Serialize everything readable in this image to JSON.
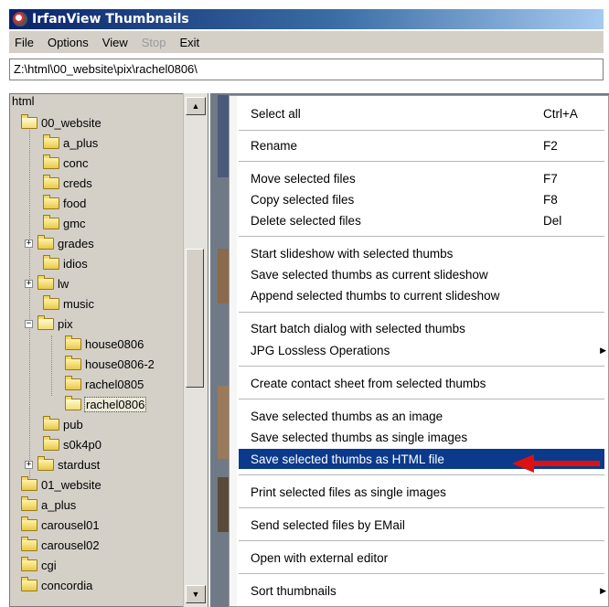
{
  "window": {
    "title": "IrfanView Thumbnails"
  },
  "menubar": {
    "items": [
      {
        "label": "File",
        "enabled": true
      },
      {
        "label": "Options",
        "enabled": true
      },
      {
        "label": "View",
        "enabled": true
      },
      {
        "label": "Stop",
        "enabled": false
      },
      {
        "label": "Exit",
        "enabled": true
      }
    ]
  },
  "address": {
    "path": "Z:\\html\\00_website\\pix\\rachel0806\\"
  },
  "tree": {
    "root_label": "html",
    "items": [
      {
        "label": "00_website",
        "expander": ""
      },
      {
        "label": "a_plus",
        "expander": ""
      },
      {
        "label": "conc",
        "expander": ""
      },
      {
        "label": "creds",
        "expander": ""
      },
      {
        "label": "food",
        "expander": ""
      },
      {
        "label": "gmc",
        "expander": ""
      },
      {
        "label": "grades",
        "expander": "+"
      },
      {
        "label": "idios",
        "expander": ""
      },
      {
        "label": "lw",
        "expander": "+"
      },
      {
        "label": "music",
        "expander": ""
      },
      {
        "label": "pix",
        "expander": "−"
      },
      {
        "label": "house0806",
        "expander": ""
      },
      {
        "label": "house0806-2",
        "expander": ""
      },
      {
        "label": "rachel0805",
        "expander": ""
      },
      {
        "label": "rachel0806",
        "expander": ""
      },
      {
        "label": "pub",
        "expander": ""
      },
      {
        "label": "s0k4p0",
        "expander": ""
      },
      {
        "label": "stardust",
        "expander": "+"
      },
      {
        "label": "01_website",
        "expander": ""
      },
      {
        "label": "a_plus",
        "expander": ""
      },
      {
        "label": "carousel01",
        "expander": ""
      },
      {
        "label": "carousel02",
        "expander": ""
      },
      {
        "label": "cgi",
        "expander": ""
      },
      {
        "label": "concordia",
        "expander": ""
      }
    ]
  },
  "context_menu": {
    "items": [
      {
        "label": "Select all",
        "shortcut": "Ctrl+A"
      },
      {
        "label": "Rename",
        "shortcut": "F2"
      },
      {
        "label": "Move selected files",
        "shortcut": "F7"
      },
      {
        "label": "Copy selected files",
        "shortcut": "F8"
      },
      {
        "label": "Delete selected files",
        "shortcut": "Del"
      },
      {
        "label": "Start slideshow with selected thumbs",
        "shortcut": ""
      },
      {
        "label": "Save selected thumbs as current slideshow",
        "shortcut": ""
      },
      {
        "label": "Append selected thumbs to current slideshow",
        "shortcut": ""
      },
      {
        "label": "Start batch dialog with selected thumbs",
        "shortcut": ""
      },
      {
        "label": "JPG Lossless Operations",
        "shortcut": ""
      },
      {
        "label": "Create contact sheet from selected thumbs",
        "shortcut": ""
      },
      {
        "label": "Save selected thumbs as an image",
        "shortcut": ""
      },
      {
        "label": "Save selected thumbs as single images",
        "shortcut": ""
      },
      {
        "label": "Save selected thumbs as HTML file",
        "shortcut": ""
      },
      {
        "label": "Print selected files as single images",
        "shortcut": ""
      },
      {
        "label": "Send selected files by EMail",
        "shortcut": ""
      },
      {
        "label": "Open with external editor",
        "shortcut": ""
      },
      {
        "label": "Sort thumbnails",
        "shortcut": ""
      }
    ],
    "highlighted_label": "Save selected thumbs as HTML file"
  },
  "colors": {
    "titlebar": "#0a246a",
    "menu_highlight": "#0b3a8c",
    "annotation_arrow": "#e01010"
  }
}
